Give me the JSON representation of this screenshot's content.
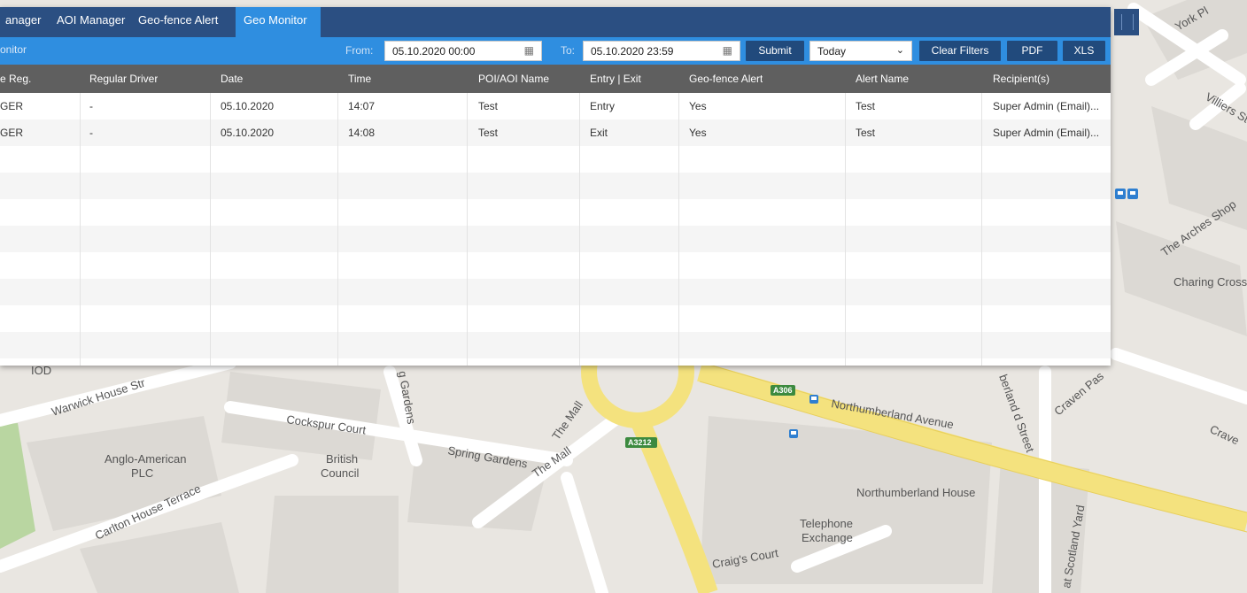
{
  "tabs": [
    {
      "label": "anager",
      "active": false
    },
    {
      "label": "AOI Manager",
      "active": false
    },
    {
      "label": "Geo-fence Alert",
      "active": false
    },
    {
      "label": "Geo Monitor",
      "active": true
    }
  ],
  "toolbar": {
    "title": "onitor",
    "from_label": "From:",
    "from_value": "05.10.2020 00:00",
    "to_label": "To:",
    "to_value": "05.10.2020 23:59",
    "submit_label": "Submit",
    "range_selected": "Today",
    "clear_label": "Clear Filters",
    "pdf_label": "PDF",
    "xls_label": "XLS"
  },
  "table": {
    "columns": [
      "e Reg.",
      "Regular Driver",
      "Date",
      "Time",
      "POI/AOI Name",
      "Entry | Exit",
      "Geo-fence Alert",
      "Alert Name",
      "Recipient(s)"
    ],
    "rows": [
      [
        "GER",
        "-",
        "05.10.2020",
        "14:07",
        "Test",
        "Entry",
        "Yes",
        "Test",
        "Super Admin (Email)..."
      ],
      [
        "GER",
        "-",
        "05.10.2020",
        "14:08",
        "Test",
        "Exit",
        "Yes",
        "Test",
        "Super Admin (Email)..."
      ]
    ]
  },
  "map": {
    "labels": {
      "york": "York Pl",
      "villiers": "Villiers St",
      "arches": "The Arches Shop",
      "charing": "Charing Cross",
      "iod": "IOD",
      "warwick": "Warwick House Str",
      "gardens": "g Gardens",
      "cockspur": "Cockspur Court",
      "spring": "Spring Gardens",
      "mall1": "The Mall",
      "mall2": "The Mall",
      "anglo1": "Anglo-American",
      "anglo2": "PLC",
      "british1": "British",
      "british2": "Council",
      "carlton": "Carlton House Terrace",
      "northumberland": "Northumberland Avenue",
      "nhouse": "Northumberland House",
      "tel1": "Telephone",
      "tel2": "Exchange",
      "craig": "Craig's Court",
      "nstreet": "berland d Street",
      "craven": "Craven Pas",
      "craven2": "Crave",
      "scotland": "at Scotland Yard",
      "a306": "A306",
      "a3212": "A3212"
    },
    "colors": {
      "road_major": "#f4e27e",
      "road_minor": "#ffffff",
      "park": "#b9d6a1",
      "land": "#e9e6e1"
    }
  },
  "colors": {
    "tabbar": "#2b4f82",
    "active_tab": "#2f8ee0",
    "toolbar": "#2f8ee0",
    "button": "#214a7c",
    "header": "#5f5f5f"
  }
}
